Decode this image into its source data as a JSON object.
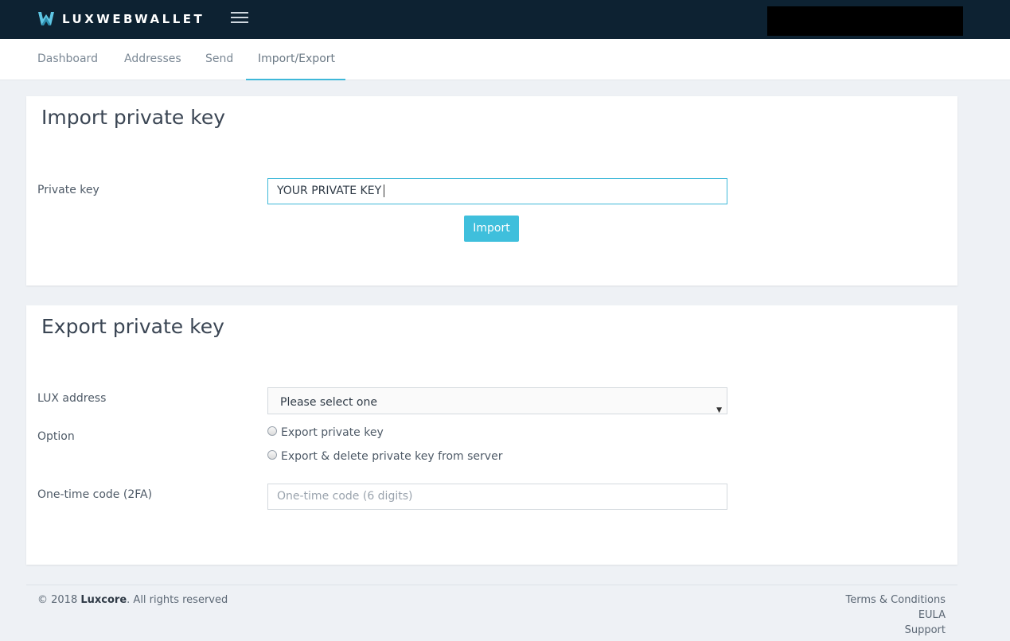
{
  "header": {
    "logo_text": "LUXWEBWALLET",
    "logo_icon": "luxcore-logo-icon",
    "menu_icon": "hamburger-icon"
  },
  "nav": {
    "tabs": [
      {
        "label": "Dashboard",
        "active": false
      },
      {
        "label": "Addresses",
        "active": false
      },
      {
        "label": "Send",
        "active": false
      },
      {
        "label": "Import/Export",
        "active": true
      }
    ]
  },
  "import_panel": {
    "title": "Import private key",
    "private_key_label": "Private key",
    "private_key_value": "YOUR PRIVATE KEY",
    "import_button": "Import"
  },
  "export_panel": {
    "title": "Export private key",
    "address_label": "LUX address",
    "address_selected": "Please select one",
    "option_label": "Option",
    "options": [
      {
        "label": "Export private key",
        "checked": false
      },
      {
        "label": "Export & delete private key from server",
        "checked": false
      }
    ],
    "otp_label": "One-time code (2FA)",
    "otp_placeholder": "One-time code (6 digits)"
  },
  "footer": {
    "copyright_prefix": "© 2018 ",
    "copyright_brand": "Luxcore",
    "copyright_suffix": ". All rights reserved",
    "links": [
      "Terms & Conditions",
      "EULA",
      "Support"
    ]
  },
  "colors": {
    "topbar": "#0d2232",
    "accent": "#3fbfdc",
    "background": "#eef1f5"
  }
}
